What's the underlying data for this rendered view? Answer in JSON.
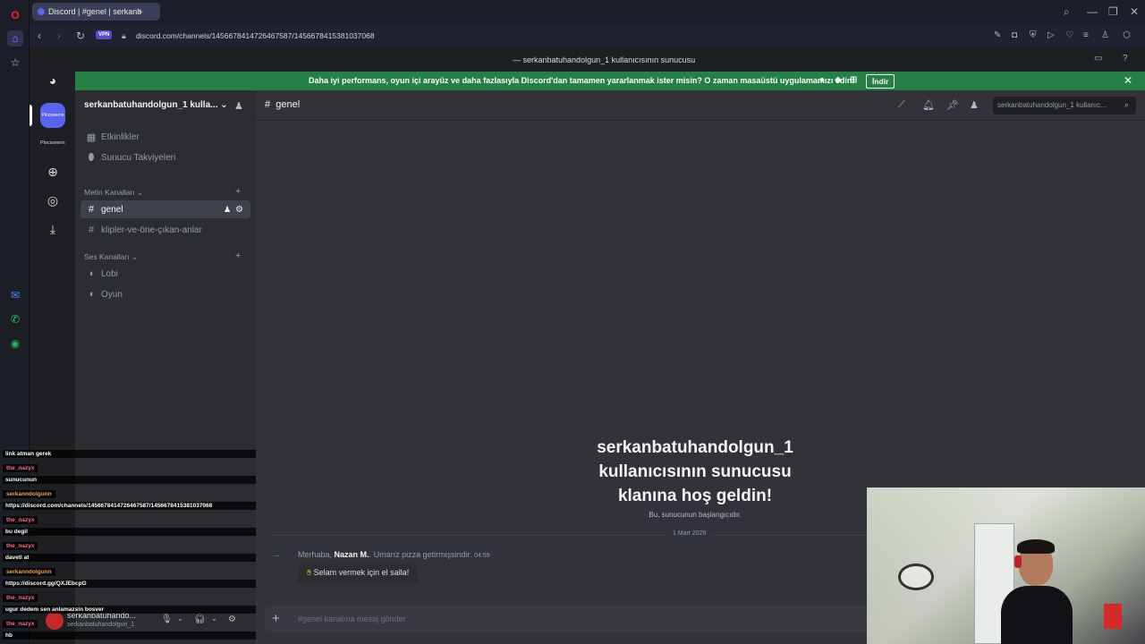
{
  "browser": {
    "tab_title": "Discord | #genel | serkanb",
    "vpn_badge": "VPN",
    "url": "discord.com/channels/1456678414726467587/1456678415381037068"
  },
  "discord": {
    "window_title": "serkanbatuhandolgun_1 kullanıcısının sunucusu",
    "banner": {
      "text": "Daha iyi performans, oyun içi arayüz ve daha fazlasıyla Discord'dan tamamen yararlanmak ister misin? O zaman masaüstü uygulamamızı edin!",
      "button": "İndir"
    },
    "guild_label": "Plocsorenn",
    "server_icon_text": "Plocsorenn",
    "server_name": "serkanbatuhandolgun_1 kulla...",
    "nav": [
      {
        "label": "Etkinlikler"
      },
      {
        "label": "Sunucu Takviyeleri"
      }
    ],
    "text_category": "Metin Kanalları",
    "text_channels": [
      {
        "label": "genel"
      },
      {
        "label": "klipler-ve-öne-çıkan-anlar"
      }
    ],
    "voice_category": "Ses Kanalları",
    "voice_channels": [
      {
        "label": "Lobi"
      },
      {
        "label": "Oyun"
      }
    ],
    "channel_title": "genel",
    "search_placeholder": "serkanbatuhandolgun_1 kullanıc...",
    "welcome": {
      "line1": "serkanbatuhandolgun_1",
      "line2": "kullanıcısının sunucusu",
      "line3": "klanına hoş geldin!",
      "sub": "Bu, sunucunun başlangıcıdır."
    },
    "date_divider": "1 Mart 2026",
    "join_message": {
      "prefix": "Merhaba,",
      "name": "Nazan M.",
      "suffix": ". Umarız pizza getirmişsindir.",
      "time": "04:59"
    },
    "wave_button": "Selam vermek için el salla!",
    "composer_placeholder": "#genel kanalına mesaj gönder",
    "user_panel": {
      "name": "serkanbatuhando...",
      "sub": "serkanbatuhandolgun_1"
    }
  },
  "chat_overlay": [
    {
      "type": "msg",
      "text": "link atman gerek"
    },
    {
      "type": "user",
      "text": "the_nazyx"
    },
    {
      "type": "msg",
      "text": "sunucunun"
    },
    {
      "type": "user2",
      "text": "serkanndolgunn"
    },
    {
      "type": "msg",
      "text": "https://discord.com/channels/1456678414726467587/1456678415381037068"
    },
    {
      "type": "user",
      "text": "the_nazyx"
    },
    {
      "type": "msg",
      "text": "bu degil"
    },
    {
      "type": "user",
      "text": "the_nazyx"
    },
    {
      "type": "msg",
      "text": "daveti at"
    },
    {
      "type": "user2",
      "text": "serkanndolgunn"
    },
    {
      "type": "msg",
      "text": "https://discord.gg/QXJEbcpG"
    },
    {
      "type": "user",
      "text": "the_nazyx"
    },
    {
      "type": "msg",
      "text": "ugur dedem sen anlamazsin bosver"
    },
    {
      "type": "user",
      "text": "the_nazyx"
    },
    {
      "type": "msg",
      "text": "hb"
    }
  ]
}
